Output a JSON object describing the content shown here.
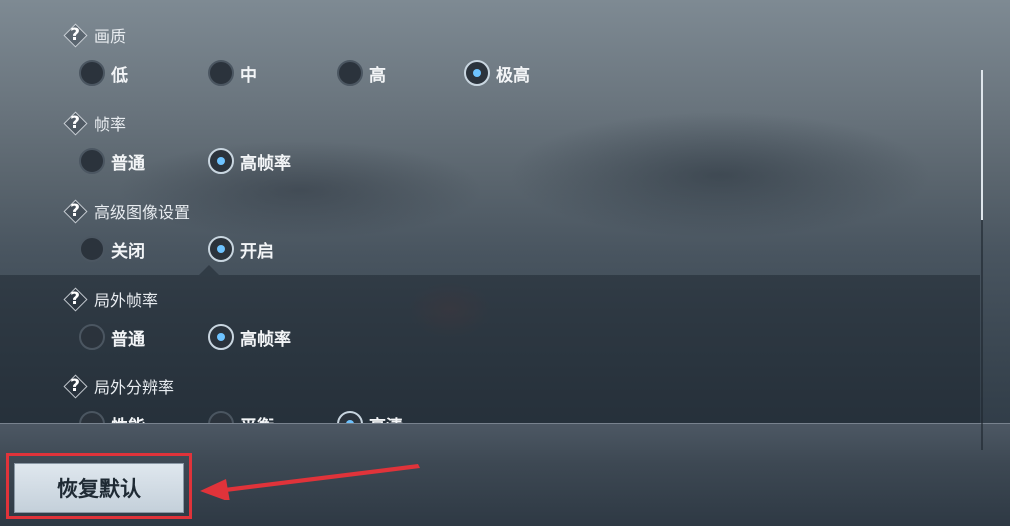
{
  "settings": [
    {
      "title": "画质",
      "options": [
        "低",
        "中",
        "高",
        "极高"
      ],
      "selected": "极高"
    },
    {
      "title": "帧率",
      "options": [
        "普通",
        "高帧率"
      ],
      "selected": "高帧率"
    },
    {
      "title": "高级图像设置",
      "options": [
        "关闭",
        "开启"
      ],
      "selected": "开启"
    },
    {
      "title": "局外帧率",
      "options": [
        "普通",
        "高帧率"
      ],
      "selected": "高帧率"
    },
    {
      "title": "局外分辨率",
      "options": [
        "性能",
        "平衡",
        "高清"
      ],
      "selected": "高清"
    }
  ],
  "help_icon_glyph": "?",
  "reset_button": {
    "label": "恢复默认"
  },
  "annotation": {
    "highlight_color": "#e0333a",
    "arrow_color": "#e0333a"
  },
  "colors": {
    "radio_selected_dot": "#6ec3ff"
  }
}
